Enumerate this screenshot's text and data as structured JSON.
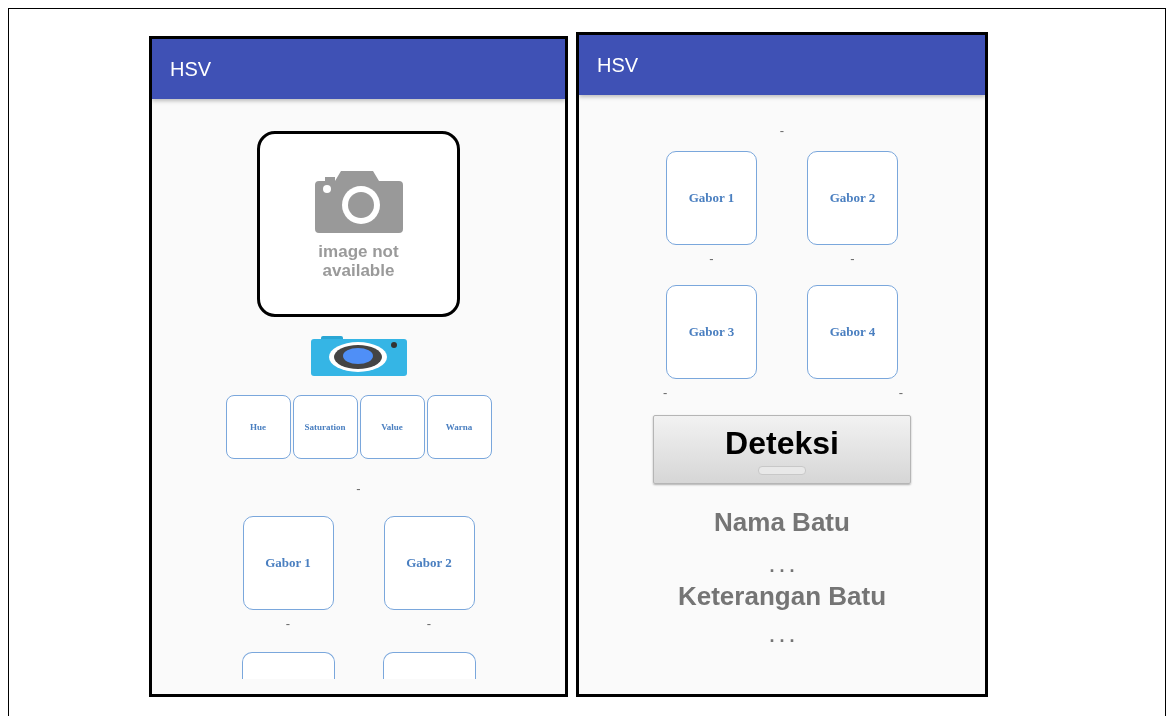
{
  "left_screen": {
    "title": "HSV",
    "placeholder_image": {
      "caption": "image not available"
    },
    "channel_buttons": [
      "Hue",
      "Saturation",
      "Value",
      "Warna"
    ],
    "channel_result": "-",
    "gabor_buttons": [
      {
        "kind": "full",
        "label": "Gabor 1",
        "result": "-"
      },
      {
        "kind": "full",
        "label": "Gabor 2",
        "result": "-"
      },
      {
        "kind": "cut"
      },
      {
        "kind": "cut"
      }
    ]
  },
  "right_screen": {
    "title": "HSV",
    "top_result": "-",
    "gabor_buttons": [
      {
        "label": "Gabor 1",
        "result": "-"
      },
      {
        "label": "Gabor 2",
        "result": "-"
      },
      {
        "label": "Gabor 3",
        "result": "-"
      },
      {
        "label": "Gabor 4",
        "result": "-"
      }
    ],
    "detect_button": "Deteksi",
    "name_label": "Nama Batu",
    "name_value": ". . .",
    "description_label": "Keterangan Batu",
    "description_value": ". . ."
  }
}
